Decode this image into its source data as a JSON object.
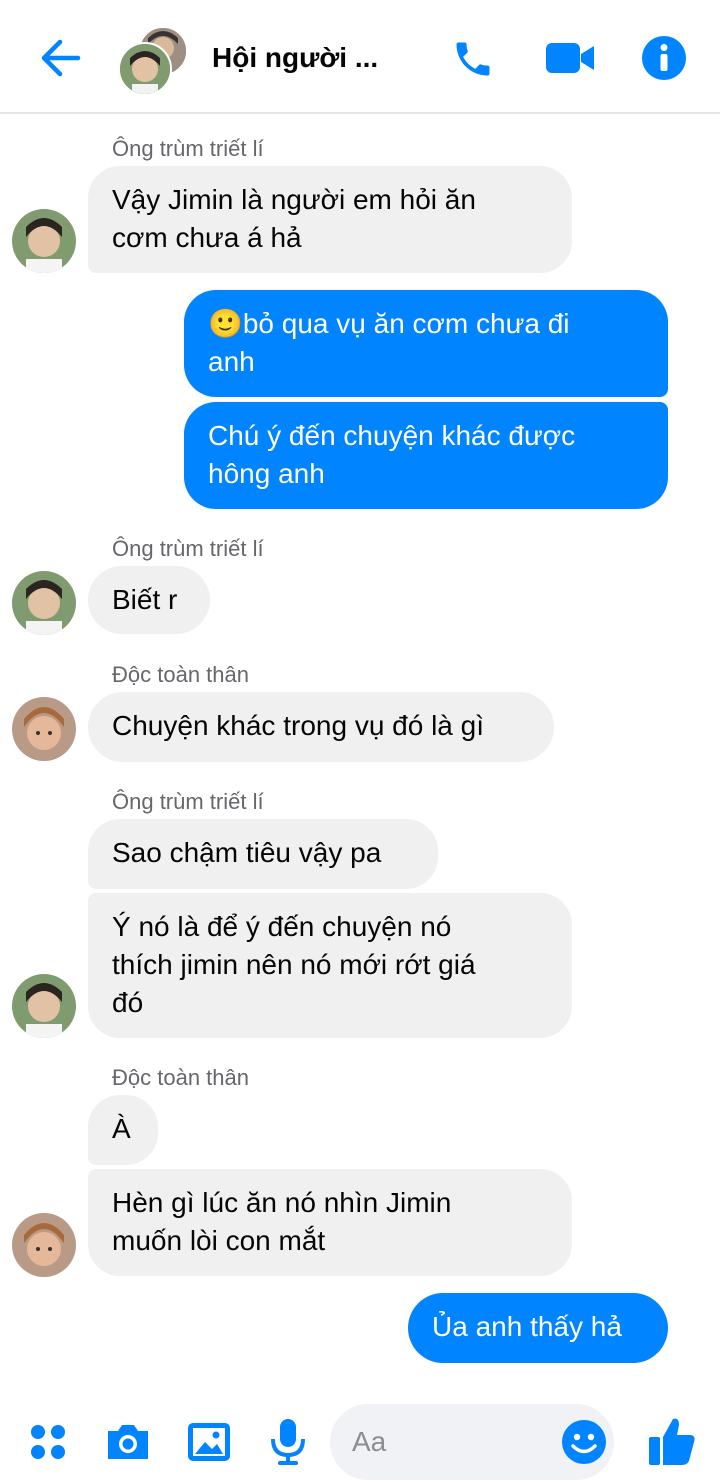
{
  "header": {
    "title": "Hội người ...",
    "icons": [
      "back-arrow-icon",
      "phone-icon",
      "video-camera-icon",
      "info-icon"
    ]
  },
  "messages": [
    {
      "sender": "Ông trùm triết lí",
      "lines": [
        "Vậy Jimin là người em hỏi ăn",
        "cơm chưa á hả"
      ]
    },
    {
      "sender": "",
      "lines": [
        "🙂bỏ qua vụ ăn cơm chưa đi",
        "anh"
      ]
    },
    {
      "sender": "",
      "lines": [
        "Chú ý đến chuyện khác được",
        "hông anh"
      ]
    },
    {
      "sender": "Ông trùm triết lí",
      "lines": [
        "Biết r"
      ]
    },
    {
      "sender": "Độc toàn thân",
      "lines": [
        "Chuyện khác trong vụ đó là gì"
      ]
    },
    {
      "sender": "Ông trùm triết lí",
      "lines": [
        "Sao chậm tiêu vậy pa"
      ]
    },
    {
      "sender": "",
      "lines": [
        "Ý nó là để ý đến chuyện nó",
        "thích jimin nên nó mới rớt giá",
        "đó"
      ]
    },
    {
      "sender": "Độc toàn thân",
      "lines": [
        "À"
      ]
    },
    {
      "sender": "",
      "lines": [
        "Hèn gì lúc ăn nó nhìn Jimin",
        "muốn lòi con mắt"
      ]
    },
    {
      "sender": "",
      "lines": [
        "Ủa anh thấy hả"
      ]
    }
  ],
  "composer": {
    "placeholder": "Aa",
    "icons": [
      "menu-dots-icon",
      "camera-icon",
      "gallery-icon",
      "microphone-icon",
      "emoji-icon",
      "like-icon"
    ]
  },
  "colors": {
    "accent": "#0084ff",
    "incoming_bubble": "#f0f0f0",
    "meta_text": "#65676b"
  }
}
